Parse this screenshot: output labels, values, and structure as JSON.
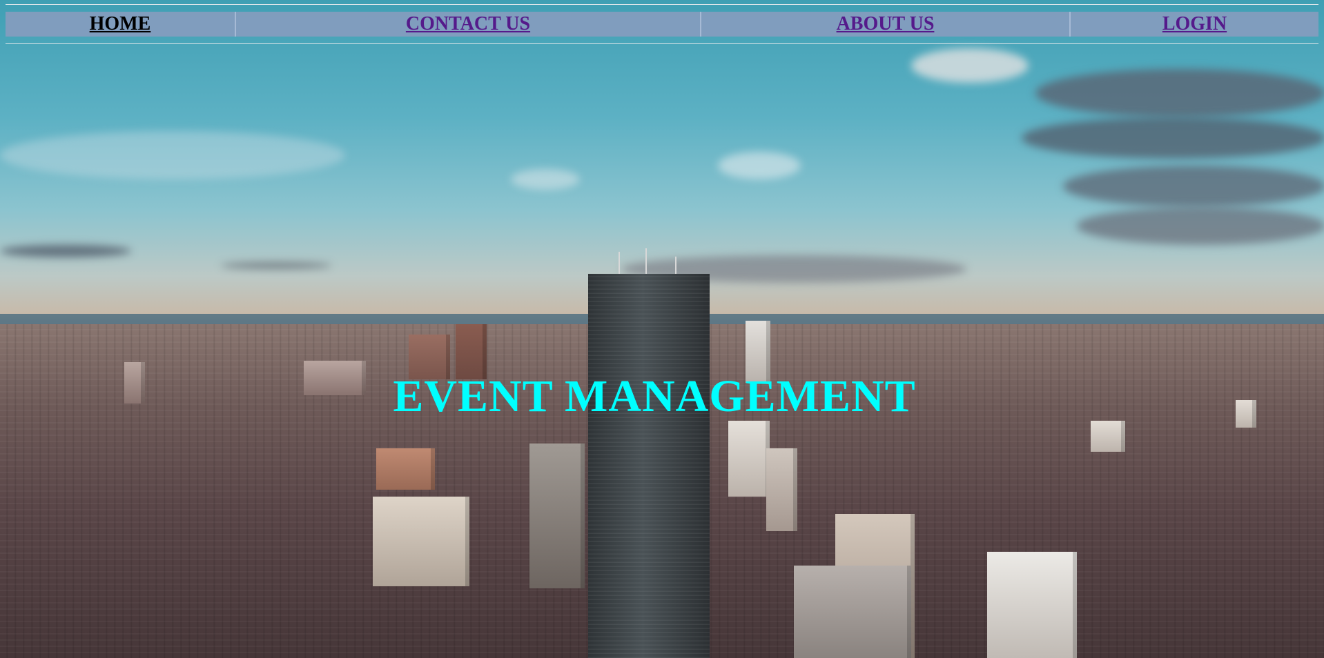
{
  "nav": {
    "items": [
      {
        "label": "HOME"
      },
      {
        "label": "CONTACT US"
      },
      {
        "label": "ABOUT US"
      },
      {
        "label": "LOGIN"
      }
    ]
  },
  "hero": {
    "title": "EVENT MANAGEMENT",
    "title_color": "#00ffff",
    "background": "aerial-city-skyline-image"
  },
  "colors": {
    "nav_bg": "#859cbe",
    "link_visited": "#551a8b",
    "link_active": "#000000"
  }
}
